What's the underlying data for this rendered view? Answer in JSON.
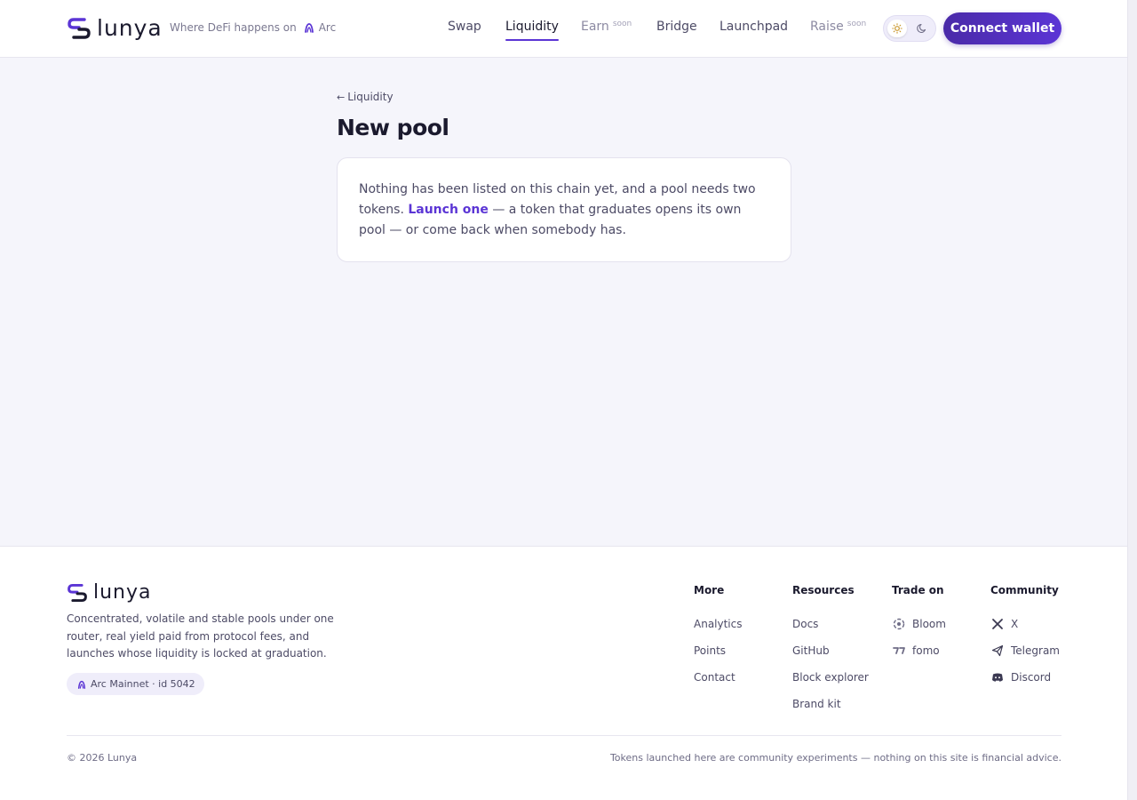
{
  "brand": {
    "name": "lunya",
    "accent": "#5b35d5"
  },
  "header": {
    "tagline": "Where DeFi happens on",
    "chain": "Arc",
    "nav": [
      {
        "label": "Swap",
        "active": false,
        "soon": ""
      },
      {
        "label": "Liquidity",
        "active": true,
        "soon": ""
      },
      {
        "label": "Earn",
        "active": false,
        "soon": "soon"
      },
      {
        "label": "Bridge",
        "active": false,
        "soon": ""
      },
      {
        "label": "Launchpad",
        "active": false,
        "soon": ""
      },
      {
        "label": "Raise",
        "active": false,
        "soon": "soon"
      }
    ],
    "connect_label": "Connect wallet"
  },
  "main": {
    "back_label": "Liquidity",
    "title": "New pool",
    "notice": {
      "before": "Nothing has been listed on this chain yet, and a pool needs two tokens. ",
      "link": "Launch one",
      "after": " — a token that graduates opens its own pool — or come back when somebody has."
    }
  },
  "footer": {
    "description": "Concentrated, volatile and stable pools under one router, real yield paid from protocol fees, and launches whose liquidity is locked at graduation.",
    "chain_badge": "Arc Mainnet · id 5042",
    "columns": [
      {
        "title": "More",
        "links": [
          {
            "label": "Analytics"
          },
          {
            "label": "Points"
          },
          {
            "label": "Contact"
          }
        ]
      },
      {
        "title": "Resources",
        "links": [
          {
            "label": "Docs"
          },
          {
            "label": "GitHub"
          },
          {
            "label": "Block explorer"
          },
          {
            "label": "Brand kit"
          }
        ]
      },
      {
        "title": "Trade on",
        "links": [
          {
            "label": "Bloom",
            "icon": "bloom-icon"
          },
          {
            "label": "fomo",
            "icon": "fomo-icon"
          }
        ]
      },
      {
        "title": "Community",
        "links": [
          {
            "label": "X",
            "icon": "x-icon"
          },
          {
            "label": "Telegram",
            "icon": "telegram-icon"
          },
          {
            "label": "Discord",
            "icon": "discord-icon"
          }
        ]
      }
    ],
    "copyright": "© 2026 Lunya",
    "disclaimer": "Tokens launched here are community experiments — nothing on this site is financial advice."
  }
}
